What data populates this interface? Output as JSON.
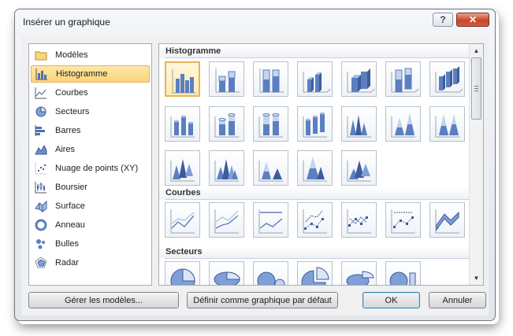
{
  "window": {
    "title": "Insérer un graphique"
  },
  "categories": [
    {
      "label": "Modèles",
      "icon": "folder-icon"
    },
    {
      "label": "Histogramme",
      "icon": "column-chart-icon",
      "selected": true
    },
    {
      "label": "Courbes",
      "icon": "line-chart-icon"
    },
    {
      "label": "Secteurs",
      "icon": "pie-chart-icon"
    },
    {
      "label": "Barres",
      "icon": "bar-chart-icon"
    },
    {
      "label": "Aires",
      "icon": "area-chart-icon"
    },
    {
      "label": "Nuage de points (XY)",
      "icon": "scatter-chart-icon"
    },
    {
      "label": "Boursier",
      "icon": "stock-chart-icon"
    },
    {
      "label": "Surface",
      "icon": "surface-chart-icon"
    },
    {
      "label": "Anneau",
      "icon": "doughnut-chart-icon"
    },
    {
      "label": "Bulles",
      "icon": "bubble-chart-icon"
    },
    {
      "label": "Radar",
      "icon": "radar-chart-icon"
    }
  ],
  "sections": {
    "histogramme": {
      "title": "Histogramme"
    },
    "courbes": {
      "title": "Courbes"
    },
    "secteurs": {
      "title": "Secteurs"
    }
  },
  "buttons": {
    "manage_templates": "Gérer les modèles...",
    "set_default": "Définir comme graphique par défaut",
    "ok": "OK",
    "cancel": "Annuler"
  },
  "colors": {
    "selection": "#fbd47b",
    "chart_blue": "#5b7fc0"
  }
}
